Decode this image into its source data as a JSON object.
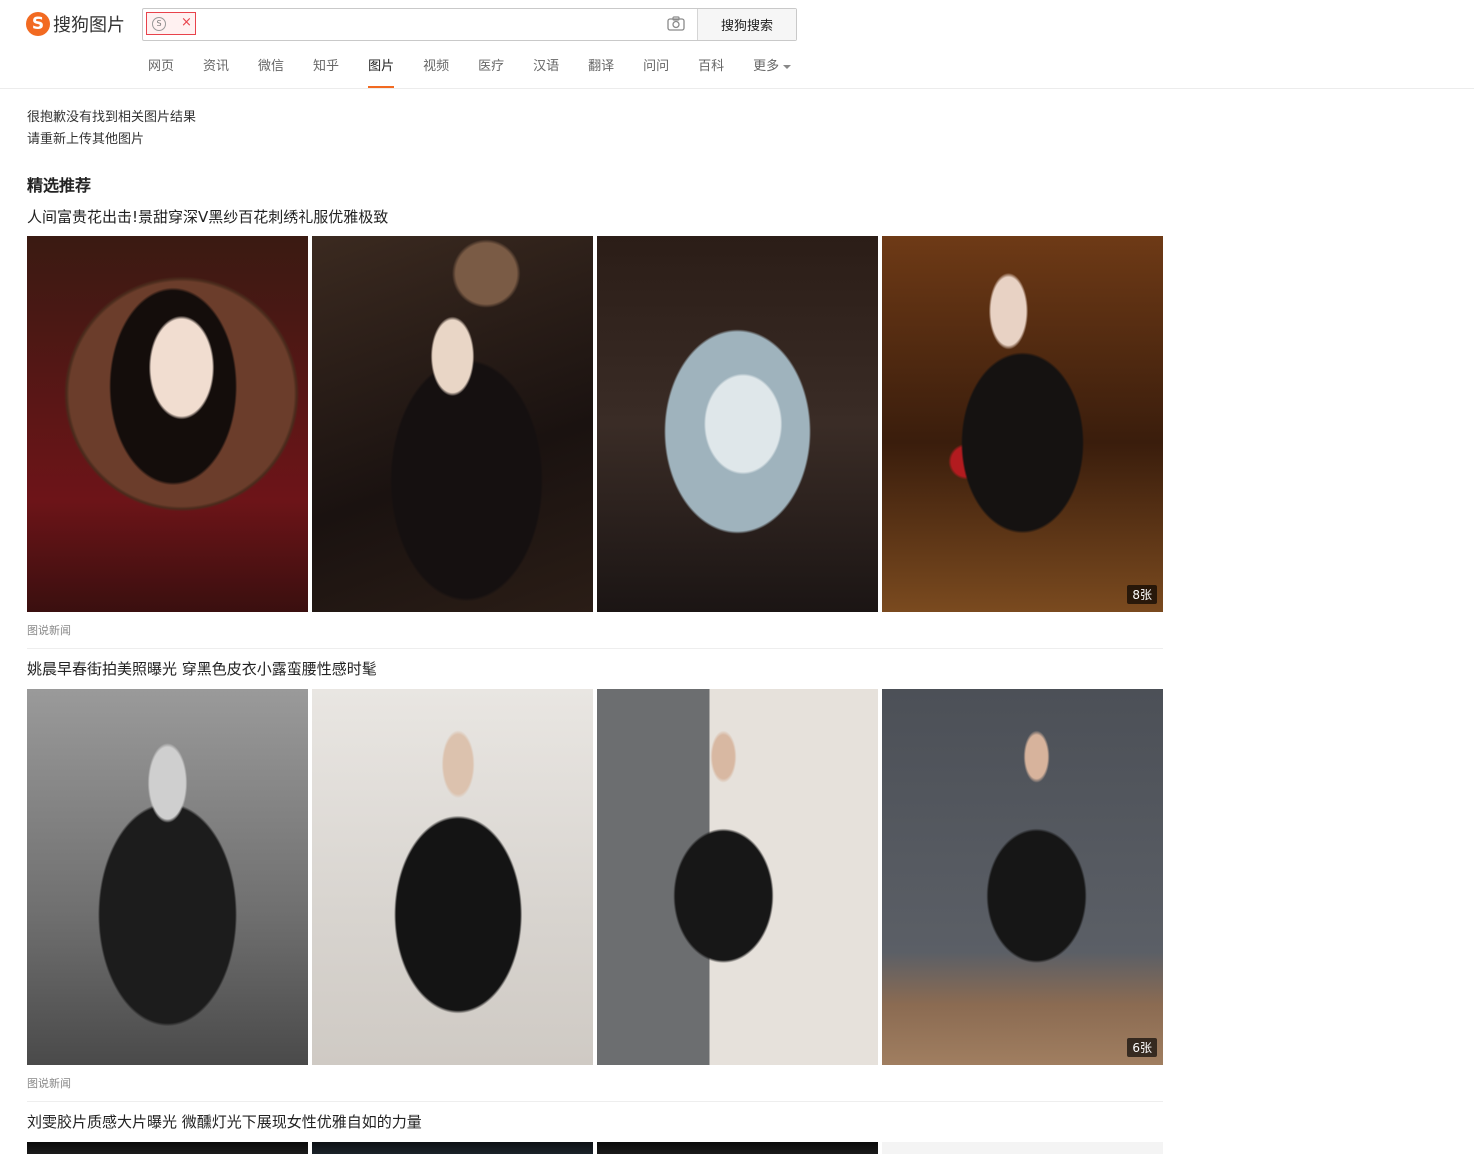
{
  "header": {
    "logo_mark": "S",
    "logo_text": "搜狗图片",
    "search": {
      "value": "",
      "placeholder": "",
      "thumb_close": "×",
      "button_label": "搜狗搜索"
    },
    "nav": [
      {
        "label": "网页",
        "active": false
      },
      {
        "label": "资讯",
        "active": false
      },
      {
        "label": "微信",
        "active": false
      },
      {
        "label": "知乎",
        "active": false
      },
      {
        "label": "图片",
        "active": true
      },
      {
        "label": "视频",
        "active": false
      },
      {
        "label": "医疗",
        "active": false
      },
      {
        "label": "汉语",
        "active": false
      },
      {
        "label": "翻译",
        "active": false
      },
      {
        "label": "问问",
        "active": false
      },
      {
        "label": "百科",
        "active": false
      }
    ],
    "nav_more": "更多"
  },
  "messages": {
    "no_result": "很抱歉没有找到相关图片结果",
    "reupload": "请重新上传其他图片"
  },
  "section_title": "精选推荐",
  "groups": [
    {
      "title": "人间富贵花出击!景甜穿深V黑纱百花刺绣礼服优雅极致",
      "count": "8张",
      "source": "图说新闻"
    },
    {
      "title": "姚晨早春街拍美照曝光 穿黑色皮衣小露蛮腰性感时髦",
      "count": "6张",
      "source": "图说新闻"
    },
    {
      "title": "刘雯胶片质感大片曝光 微醺灯光下展现女性优雅自如的力量"
    }
  ],
  "colors": {
    "brand": "#f26a21",
    "chip_border": "#e8424b"
  },
  "icons": {
    "logo": "sogou-logo-icon",
    "camera": "camera-icon",
    "caret": "caret-down-icon"
  }
}
